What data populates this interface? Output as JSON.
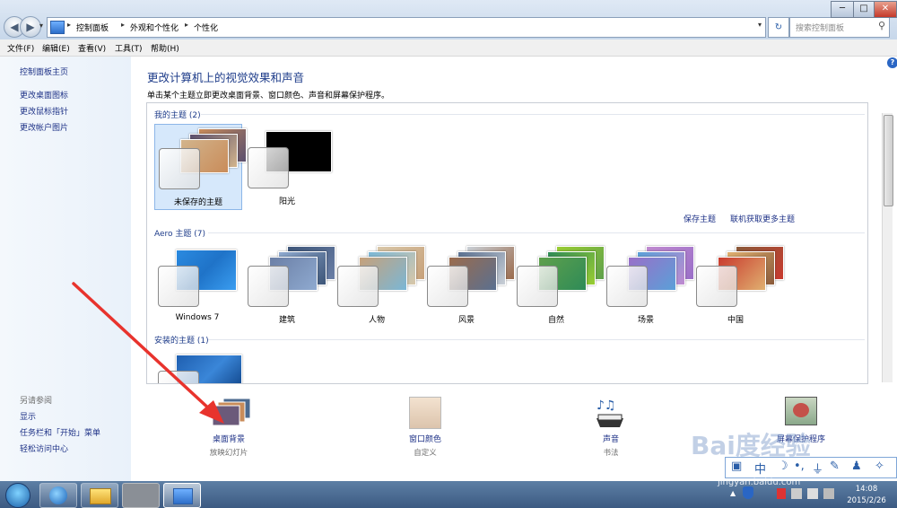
{
  "window": {
    "breadcrumb": [
      "控制面板",
      "外观和个性化",
      "个性化"
    ],
    "search_placeholder": "搜索控制面板",
    "controls": {
      "min": "─",
      "max": "□",
      "close": "✕"
    }
  },
  "menubar": [
    "文件(F)",
    "编辑(E)",
    "查看(V)",
    "工具(T)",
    "帮助(H)"
  ],
  "sidebar": {
    "home": "控制面板主页",
    "links": [
      "更改桌面图标",
      "更改鼠标指针",
      "更改帐户图片"
    ],
    "see_also_header": "另请参阅",
    "see_also": [
      "显示",
      "任务栏和「开始」菜单",
      "轻松访问中心"
    ]
  },
  "main": {
    "title": "更改计算机上的视觉效果和声音",
    "subtitle": "单击某个主题立即更改桌面背景、窗口颜色、声音和屏幕保护程序。",
    "my_themes": {
      "header": "我的主题 (2)",
      "items": [
        {
          "label": "未保存的主题",
          "selected": true,
          "colors": [
            "#c98c5a",
            "#5a4f6e",
            "#d2b48c"
          ]
        },
        {
          "label": "阳光",
          "selected": false,
          "colors": [
            "#000000",
            "#000000",
            "#000000"
          ]
        }
      ],
      "save_link": "保存主题",
      "online_link": "联机获取更多主题"
    },
    "aero_themes": {
      "header": "Aero 主题 (7)",
      "items": [
        {
          "label": "Windows 7",
          "colors": [
            "#1f73c8",
            "#2a8ae0",
            "#3a9df0"
          ]
        },
        {
          "label": "建筑",
          "colors": [
            "#6b7fa6",
            "#8faad0",
            "#3d5578"
          ]
        },
        {
          "label": "人物",
          "colors": [
            "#c7a17a",
            "#7ab7d6",
            "#d9c7a8"
          ]
        },
        {
          "label": "风景",
          "colors": [
            "#9b6b4c",
            "#5a7090",
            "#c9cfd6"
          ]
        },
        {
          "label": "自然",
          "colors": [
            "#5fa04c",
            "#2e8b57",
            "#9acd32"
          ]
        },
        {
          "label": "场景",
          "colors": [
            "#9a6fc8",
            "#5aa0d8",
            "#c08ad0"
          ]
        },
        {
          "label": "中国",
          "colors": [
            "#c93a2e",
            "#e0b070",
            "#8a5a3a"
          ]
        }
      ]
    },
    "installed_themes": {
      "header": "安装的主题 (1)",
      "colors": [
        "#1f5fb0",
        "#3a86d8",
        "#0b3d80"
      ]
    }
  },
  "bottom": [
    {
      "label": "桌面背景",
      "sub": "放映幻灯片",
      "icon": "desktop-background-icon"
    },
    {
      "label": "窗口颜色",
      "sub": "自定义",
      "icon": "window-color-icon"
    },
    {
      "label": "声音",
      "sub": "书法",
      "icon": "sounds-icon"
    },
    {
      "label": "屏幕保护程序",
      "sub": "",
      "icon": "screensaver-icon"
    }
  ],
  "taskbar": {
    "clock_time": "14:08",
    "clock_date": "2015/2/26"
  },
  "watermark": {
    "brand": "Bai度经验",
    "url": "jingyan.baidu.com"
  }
}
